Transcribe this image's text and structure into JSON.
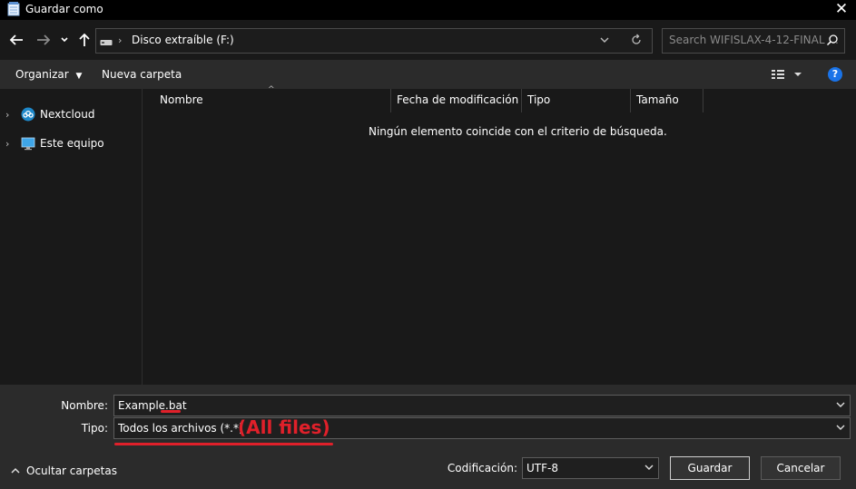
{
  "window": {
    "title": "Guardar como",
    "icon": "notepad-icon"
  },
  "nav": {
    "back_icon": "arrow-left-icon",
    "forward_icon": "arrow-right-icon",
    "recent_icon": "chevron-down-icon",
    "up_icon": "arrow-up-icon",
    "address": "Disco extraíble (F:)",
    "search_placeholder": "Search WIFISLAX-4-12-FINAL ..."
  },
  "toolbar": {
    "organize_label": "Organizar",
    "new_folder_label": "Nueva carpeta"
  },
  "sidebar": {
    "items": [
      {
        "label": "Nextcloud",
        "icon": "nextcloud-icon"
      },
      {
        "label": "Este equipo",
        "icon": "computer-icon"
      }
    ]
  },
  "columns": {
    "headers": [
      "Nombre",
      "Fecha de modificación",
      "Tipo",
      "Tamaño"
    ]
  },
  "content": {
    "empty_message": "Ningún elemento coincide con el criterio de búsqueda."
  },
  "form": {
    "name_label": "Nombre:",
    "name_value": "Example.bat",
    "type_label": "Tipo:",
    "type_value": "Todos los archivos  (*.*)",
    "encoding_label": "Codificación:",
    "encoding_value": "UTF-8",
    "hide_folders_label": "Ocultar carpetas",
    "save_label": "Guardar",
    "cancel_label": "Cancelar"
  },
  "annotation": {
    "text": "(All files)",
    "color": "#e0202a"
  },
  "colors": {
    "background": "#191919",
    "bar": "#2b2b2b",
    "help": "#1a73e8"
  }
}
